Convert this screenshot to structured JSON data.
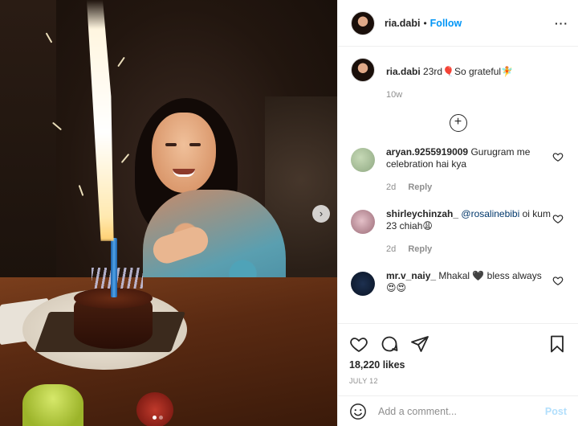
{
  "post": {
    "username": "ria.dabi",
    "separator": "•",
    "follow_label": "Follow",
    "more_label": "···",
    "caption_text": "23rd🎈So grateful🧚",
    "caption_age": "10w",
    "load_more_label": "+"
  },
  "comments": [
    {
      "username": "aryan.9255919009",
      "pre": "",
      "mention": "",
      "text": "Gurugram me celebration hai kya",
      "age": "2d",
      "reply_label": "Reply"
    },
    {
      "username": "shirleychinzah_",
      "pre": "",
      "mention": "@rosalinebibi",
      "text": " oi kum 23 chiah😩",
      "age": "2d",
      "reply_label": "Reply"
    },
    {
      "username": "mr.v_naiy_",
      "pre": "",
      "mention": "",
      "text": "Mhakal 🖤 bless always😍😍",
      "age": "",
      "reply_label": ""
    }
  ],
  "stats": {
    "likes": "18,220 likes",
    "date": "JULY 12"
  },
  "composer": {
    "placeholder": "Add a comment...",
    "post_label": "Post"
  },
  "icons": {
    "next": "chevron-right-icon",
    "like": "heart-icon",
    "comment": "comment-bubble-icon",
    "share": "paper-plane-icon",
    "save": "bookmark-icon",
    "emoji": "smiley-icon"
  },
  "colors": {
    "link_blue": "#0095f6",
    "muted": "#8e8e8e",
    "post_disabled": "#b2dffc"
  }
}
